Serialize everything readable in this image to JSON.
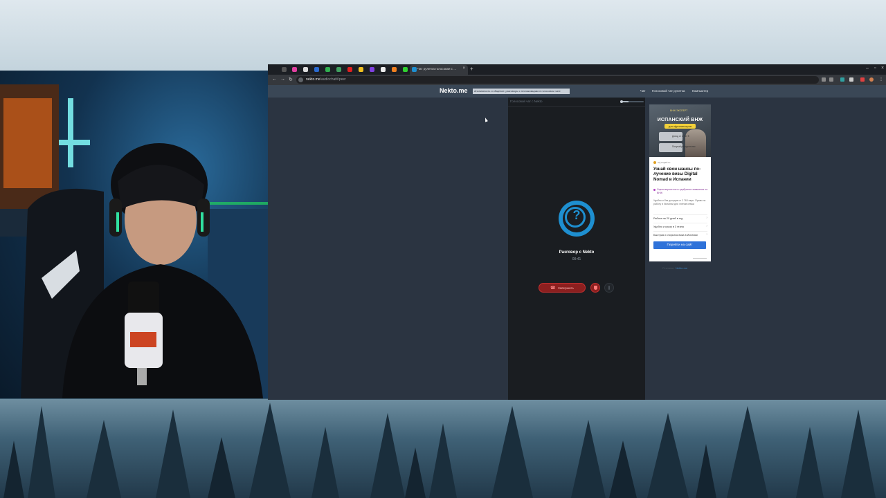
{
  "browser": {
    "active_tab_title": "Чат рулетка голосовая с …",
    "url_host": "nekto.me",
    "url_path": "/audiochat#/peer"
  },
  "site": {
    "logo": "Nekto.me",
    "promo": "Анонимность и общение: разговоры с незнакомцами в голосовом чате",
    "nav": [
      "Чат",
      "Голосовой чат рулетка",
      "Компьютер"
    ],
    "chat_header": "Голосовой чат с Nekto",
    "conversation_title": "Разговор с Nekto",
    "timer": "00:41",
    "end_button": "Завершить"
  },
  "ad": {
    "brand": "ВНЖ ЭКСПЕРТ",
    "headline": "ИСПАНСКИЙ ВНЖ",
    "pill": "для фрилансеров",
    "card1": "Доход от 2 763 €",
    "card2": "Получай резидентство",
    "source": "vnj-expert.ru",
    "title": "Узнай свои шансы по-лучение визы Digital Nomad в Испании",
    "note": "Оцени вероятность одобрения заявления на ВНЖ",
    "text": "Удобно и без доходов от 2 763 евро. Право на работу в Испании для членов семьи",
    "rows": [
      "Работа на 20 дней в год",
      "Удобно и сразу в 3 этапа",
      "Быстрая и открытая виза в Испании"
    ],
    "button": "Перейти на сайт",
    "footer_prefix": "Реклама",
    "footer_link": "Nekto.me"
  },
  "colors": {
    "accent": "#1e8fd0",
    "end_red": "#8c1f1f",
    "ad_button": "#2f72d9",
    "page_bg": "#2b3441"
  }
}
